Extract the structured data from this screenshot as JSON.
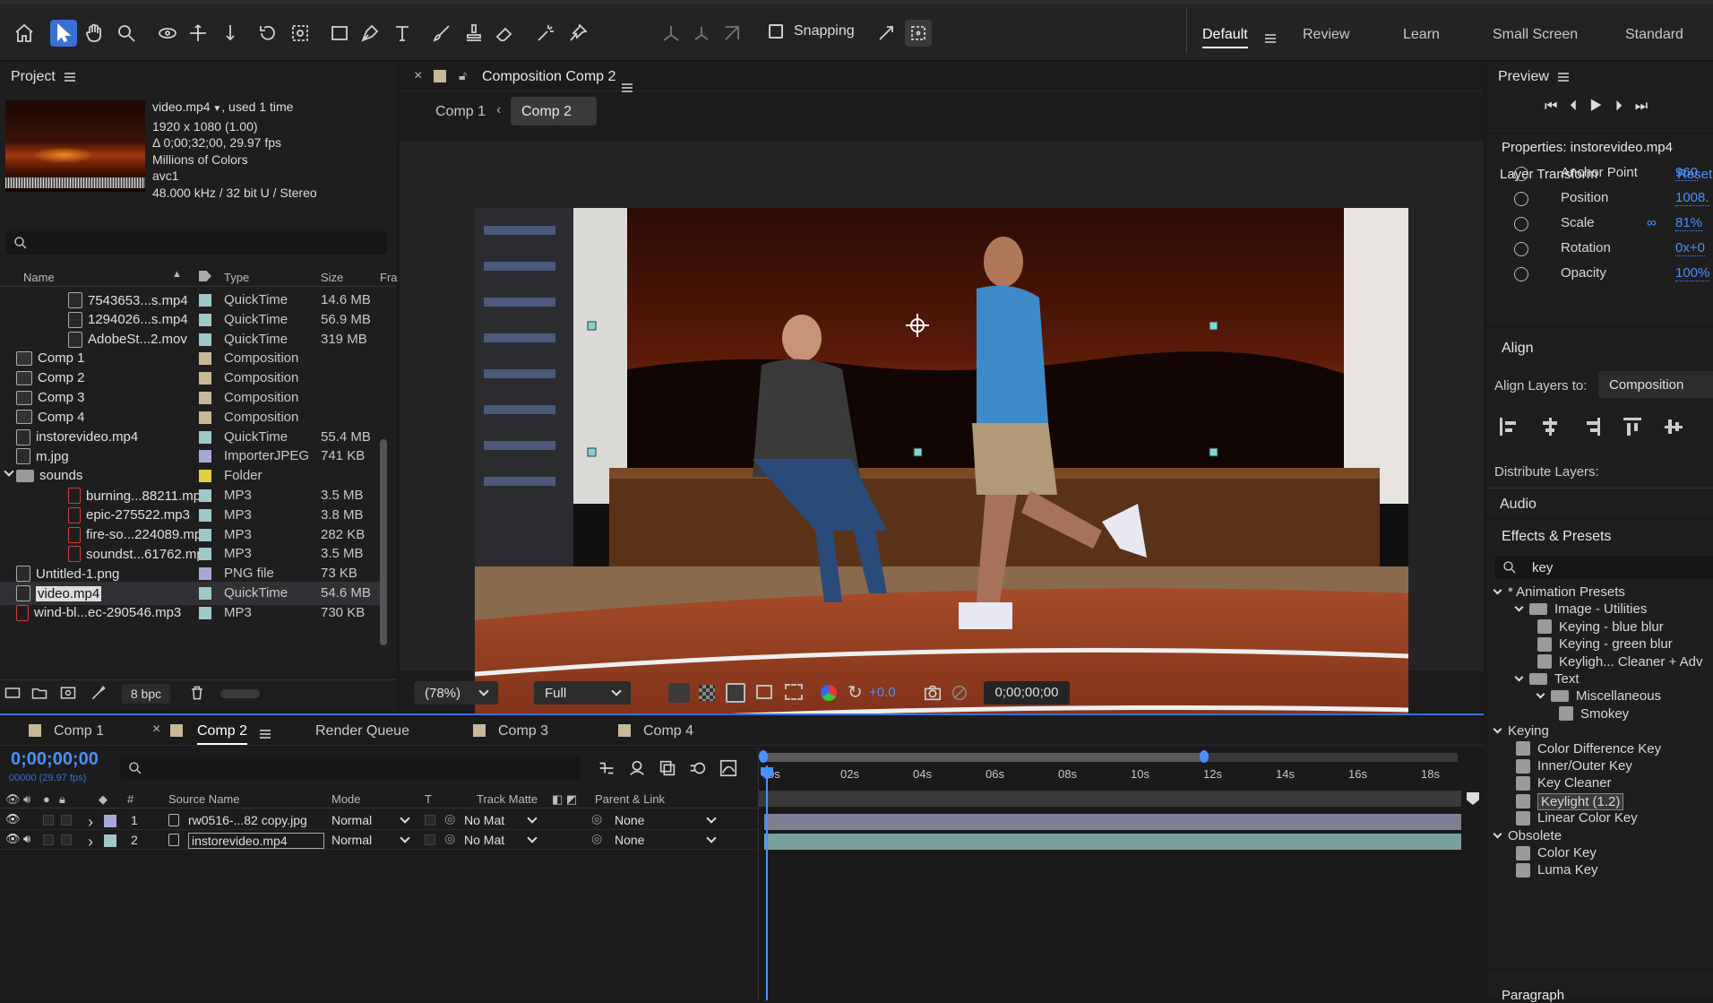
{
  "topbar": {
    "snapping_label": "Snapping",
    "workspaces": [
      "Default",
      "Review",
      "Learn",
      "Small Screen",
      "Standard"
    ]
  },
  "project": {
    "title": "Project",
    "info": {
      "name": "video.mp4",
      "usage": ", used 1 time",
      "resolution": "1920 x 1080 (1.00)",
      "duration": "Δ 0;00;32;00, 29.97 fps",
      "colors": "Millions of Colors",
      "codec": "avc1",
      "audio": "48.000 kHz / 32 bit U / Stereo"
    },
    "columns": {
      "name": "Name",
      "type": "Type",
      "size": "Size",
      "frame": "Fra"
    },
    "items": [
      {
        "name": "7543653...s.mp4",
        "type": "QuickTime",
        "size": "14.6 MB",
        "color": "#a0c8c8"
      },
      {
        "name": "1294026...s.mp4",
        "type": "QuickTime",
        "size": "56.9 MB",
        "color": "#a0c8c8"
      },
      {
        "name": "AdobeSt...2.mov",
        "type": "QuickTime",
        "size": "319 MB",
        "color": "#a0c8c8"
      },
      {
        "name": "Comp 1",
        "type": "Composition",
        "size": "",
        "color": "#c8b896"
      },
      {
        "name": "Comp 2",
        "type": "Composition",
        "size": "",
        "color": "#c8b896"
      },
      {
        "name": "Comp 3",
        "type": "Composition",
        "size": "",
        "color": "#c8b896"
      },
      {
        "name": "Comp 4",
        "type": "Composition",
        "size": "",
        "color": "#c8b896"
      },
      {
        "name": "instorevideo.mp4",
        "type": "QuickTime",
        "size": "55.4 MB",
        "color": "#a0c8c8"
      },
      {
        "name": "m.jpg",
        "type": "ImporterJPEG",
        "size": "741 KB",
        "color": "#a8a8d8"
      },
      {
        "name": "sounds",
        "type": "Folder",
        "size": "",
        "color": "#e0d040"
      },
      {
        "name": "burning...88211.mp3",
        "type": "MP3",
        "size": "3.5 MB",
        "color": "#a0c8c8"
      },
      {
        "name": "epic-275522.mp3",
        "type": "MP3",
        "size": "3.8 MB",
        "color": "#a0c8c8"
      },
      {
        "name": "fire-so...224089.mp3",
        "type": "MP3",
        "size": "282 KB",
        "color": "#a0c8c8"
      },
      {
        "name": "soundst...61762.mp3",
        "type": "MP3",
        "size": "3.5 MB",
        "color": "#a0c8c8"
      },
      {
        "name": "Untitled-1.png",
        "type": "PNG file",
        "size": "73 KB",
        "color": "#a8a8d8"
      },
      {
        "name": "video.mp4",
        "type": "QuickTime",
        "size": "54.6 MB",
        "color": "#a0c8c8"
      },
      {
        "name": "wind-bl...ec-290546.mp3",
        "type": "MP3",
        "size": "730 KB",
        "color": "#a0c8c8"
      }
    ],
    "bpc": "8 bpc"
  },
  "composition": {
    "title": "Composition Comp 2",
    "breadcrumbs": [
      "Comp 1",
      "Comp 2"
    ],
    "zoom": "(78%)",
    "resolution": "Full",
    "exposure": "+0.0",
    "timecode": "0;00;00;00"
  },
  "timeline": {
    "tabs": [
      "Comp 1",
      "Comp 2",
      "Render Queue",
      "Comp 3",
      "Comp 4"
    ],
    "timecode": "0;00;00;00",
    "frame_info": "00000 (29.97 fps)",
    "columns": {
      "num": "#",
      "source": "Source Name",
      "mode": "Mode",
      "t": "T",
      "track_matte": "Track Matte",
      "parent": "Parent & Link"
    },
    "layers": [
      {
        "num": "1",
        "name": "rw0516-...82 copy.jpg",
        "mode": "Normal",
        "matte": "No Mat",
        "parent": "None",
        "color": "#a8a8d8"
      },
      {
        "num": "2",
        "name": "instorevideo.mp4",
        "mode": "Normal",
        "matte": "No Mat",
        "parent": "None",
        "color": "#a0c8c8"
      }
    ],
    "ruler": [
      "0s",
      "02s",
      "04s",
      "06s",
      "08s",
      "10s",
      "12s",
      "14s",
      "16s",
      "18s"
    ]
  },
  "preview": {
    "title": "Preview"
  },
  "properties": {
    "title": "Properties: instorevideo.mp4",
    "section": "Layer Transform",
    "reset": "Reset",
    "rows": [
      {
        "label": "Anchor Point",
        "value": "960"
      },
      {
        "label": "Position",
        "value": "1008."
      },
      {
        "label": "Scale",
        "value": "81%"
      },
      {
        "label": "Rotation",
        "value": "0x+0"
      },
      {
        "label": "Opacity",
        "value": "100%"
      }
    ]
  },
  "align": {
    "title": "Align",
    "align_to_label": "Align Layers to:",
    "align_to_value": "Composition",
    "distribute_label": "Distribute Layers:",
    "audio_label": "Audio"
  },
  "effects": {
    "title": "Effects & Presets",
    "search": "key",
    "tree": [
      {
        "label": "* Animation Presets",
        "level": 0,
        "kind": "group"
      },
      {
        "label": "Image - Utilities",
        "level": 1,
        "kind": "folder"
      },
      {
        "label": "Keying - blue blur",
        "level": 2,
        "kind": "item"
      },
      {
        "label": "Keying - green blur",
        "level": 2,
        "kind": "item"
      },
      {
        "label": "Keyligh... Cleaner + Adv",
        "level": 2,
        "kind": "item"
      },
      {
        "label": "Text",
        "level": 1,
        "kind": "folder"
      },
      {
        "label": "Miscellaneous",
        "level": 2,
        "kind": "folder"
      },
      {
        "label": "Smokey",
        "level": 3,
        "kind": "item"
      },
      {
        "label": "Keying",
        "level": 0,
        "kind": "group"
      },
      {
        "label": "Color Difference Key",
        "level": 1,
        "kind": "item"
      },
      {
        "label": "Inner/Outer Key",
        "level": 1,
        "kind": "item"
      },
      {
        "label": "Key Cleaner",
        "level": 1,
        "kind": "item"
      },
      {
        "label": "Keylight (1.2)",
        "level": 1,
        "kind": "item",
        "selected": true
      },
      {
        "label": "Linear Color Key",
        "level": 1,
        "kind": "item"
      },
      {
        "label": "Obsolete",
        "level": 0,
        "kind": "group"
      },
      {
        "label": "Color Key",
        "level": 1,
        "kind": "item"
      },
      {
        "label": "Luma Key",
        "level": 1,
        "kind": "item"
      }
    ]
  },
  "paragraph": {
    "title": "Paragraph"
  }
}
